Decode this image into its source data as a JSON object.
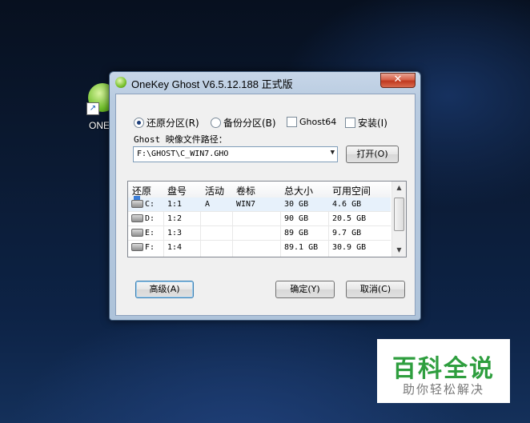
{
  "desktop": {
    "icon_label": "ONEK",
    "icon_name": "onekey-ghost-app-icon"
  },
  "window": {
    "title": "OneKey Ghost V6.5.12.188 正式版",
    "close_symbol": "✕"
  },
  "options": {
    "restore": "还原分区(R)",
    "backup": "备份分区(B)",
    "ghost64": "Ghost64",
    "install": "安装(I)",
    "selected": "restore"
  },
  "path": {
    "label": "Ghost 映像文件路径：",
    "value": "F:\\GHOST\\C_WIN7.GHO",
    "open_button": "打开(O)"
  },
  "table": {
    "columns": [
      "还原",
      "盘号",
      "活动",
      "卷标",
      "总大小",
      "可用空间"
    ],
    "rows": [
      {
        "drive": "C:",
        "disk": "1:1",
        "active": "A",
        "label": "WIN7",
        "total": "30 GB",
        "free": "4.6 GB"
      },
      {
        "drive": "D:",
        "disk": "1:2",
        "active": "",
        "label": "",
        "total": "90 GB",
        "free": "20.5 GB"
      },
      {
        "drive": "E:",
        "disk": "1:3",
        "active": "",
        "label": "",
        "total": "89 GB",
        "free": "9.7 GB"
      },
      {
        "drive": "F:",
        "disk": "1:4",
        "active": "",
        "label": "",
        "total": "89.1 GB",
        "free": "30.9 GB"
      }
    ]
  },
  "buttons": {
    "advanced": "高级(A)",
    "ok": "确定(Y)",
    "cancel": "取消(C)"
  },
  "watermark": {
    "main": "百科全说",
    "sub": "助你轻松解决",
    "color": "#2e9e3e"
  }
}
